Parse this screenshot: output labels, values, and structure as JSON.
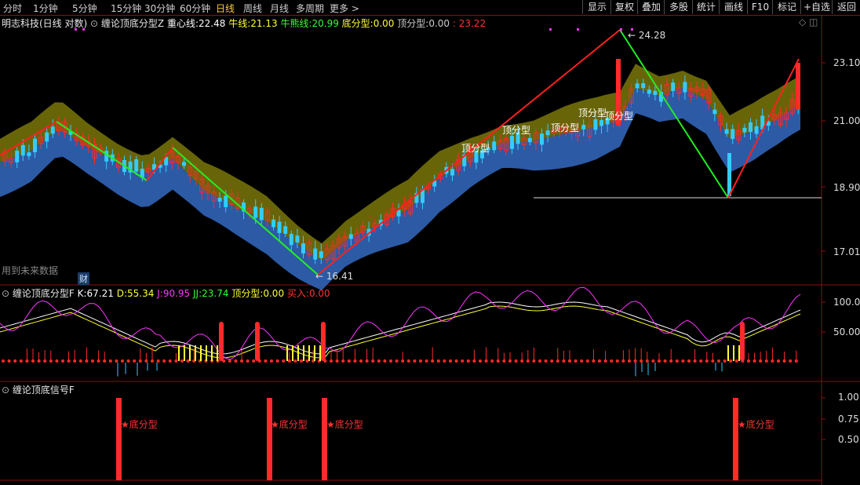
{
  "periods": [
    "分时",
    "1分钟",
    "5分钟",
    "15分钟",
    "30分钟",
    "60分钟",
    "日线",
    "周线",
    "月线",
    "多周期",
    "更多"
  ],
  "active_period": "日线",
  "more_arrow": ">",
  "right_buttons": [
    "显示",
    "复权",
    "叠加",
    "多股",
    "统计",
    "画线",
    "F10",
    "标记",
    "+自选",
    "返回"
  ],
  "stock_title": "明志科技(日线 对数)",
  "main_indicator": {
    "name": "缠论顶底分型Z",
    "center_label": "重心线:",
    "center_value": "22.48",
    "bull_label": "牛线:",
    "bull_value": "21.13",
    "bear_label": "牛熊线:",
    "bear_value": "20.99",
    "bottom_label": "底分型:",
    "bottom_value": "0.00",
    "top_label": "顶分型:",
    "top_value": "0.00",
    "extra_value": "23.22"
  },
  "price_axis": [
    "23.10",
    "21.00",
    "18.90",
    "17.01"
  ],
  "price_high_label": "24.28",
  "price_low_label": "16.41",
  "future_data_note": "用到未来数据",
  "finance_marker": "财",
  "top_fractal_label": "顶分型",
  "kdj_indicator": {
    "name": "缠论顶底分型F",
    "k_label": "K:",
    "k_value": "67.21",
    "d_label": "D:",
    "d_value": "55.34",
    "j_label": "J:",
    "j_value": "90.95",
    "jj_label": "JJ:",
    "jj_value": "23.74",
    "top_label": "顶分型:",
    "top_value": "0.00",
    "buy_label": "买入:",
    "buy_value": "0.00"
  },
  "kdj_axis": [
    "100.0",
    "50.00"
  ],
  "signal_indicator": {
    "name": "缠论顶底信号F",
    "signal_label": "★底分型"
  },
  "signal_axis": [
    "1.00",
    "0.75",
    "0.50"
  ],
  "colors": {
    "up": "#ff2a2a",
    "down": "#33ccff",
    "olive": "#6e6a0a",
    "blue_band": "#2e5fae",
    "zigzag_up": "#ff2020",
    "zigzag_down": "#22ee22",
    "kdj_k": "#ffffff",
    "kdj_d": "#ffff33",
    "kdj_j": "#ff33ff"
  }
}
